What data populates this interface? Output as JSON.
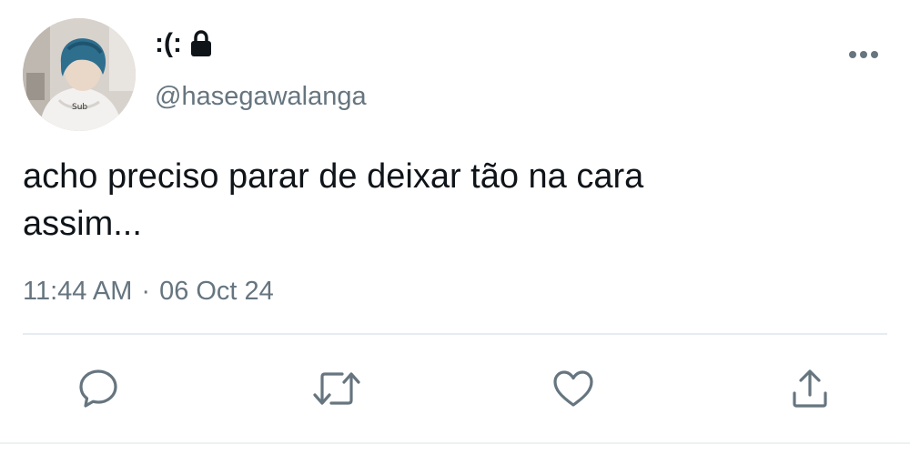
{
  "author": {
    "display_name": ":(:",
    "handle": "@hasegawalanga",
    "protected": true,
    "avatar_icon": "profile-photo"
  },
  "tweet": {
    "text": "acho preciso parar de deixar tão na cara\nassim...",
    "time": "11:44 AM",
    "separator": "·",
    "date": "06 Oct 24"
  },
  "actions": {
    "reply_icon": "reply-icon",
    "retweet_icon": "retweet-icon",
    "like_icon": "like-icon",
    "share_icon": "share-icon"
  },
  "colors": {
    "text_primary": "#0f1419",
    "text_secondary": "#66757f",
    "icon": "#66757f",
    "divider": "#e6ecf0"
  }
}
